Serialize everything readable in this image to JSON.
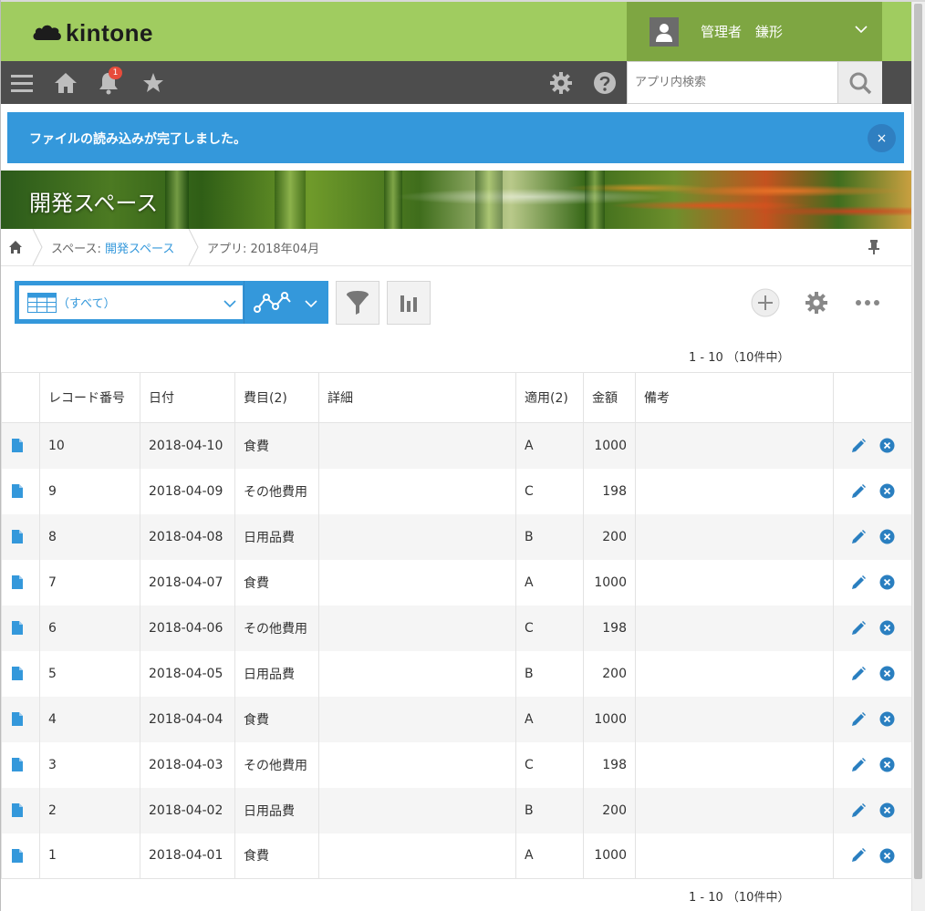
{
  "header": {
    "logo_text": "kintone",
    "user_name": "管理者　鎌形"
  },
  "navbar": {
    "notification_count": "1",
    "search_placeholder": "アプリ内検索"
  },
  "notice": {
    "message": "ファイルの読み込みが完了しました。",
    "close_label": "×"
  },
  "space": {
    "title": "開発スペース"
  },
  "breadcrumb": {
    "space_prefix": "スペース: ",
    "space_name": "開発スペース",
    "app_label": "アプリ: 2018年04月"
  },
  "view": {
    "selected": "（すべて）"
  },
  "pager": {
    "text": "1 - 10 （10件中）"
  },
  "table": {
    "columns": [
      "レコード番号",
      "日付",
      "費目(2)",
      "詳細",
      "適用(2)",
      "金額",
      "備考"
    ],
    "rows": [
      {
        "id": "10",
        "date": "2018-04-10",
        "category": "食費",
        "detail": "",
        "apply": "A",
        "amount": "1000",
        "note": ""
      },
      {
        "id": "9",
        "date": "2018-04-09",
        "category": "その他費用",
        "detail": "",
        "apply": "C",
        "amount": "198",
        "note": ""
      },
      {
        "id": "8",
        "date": "2018-04-08",
        "category": "日用品費",
        "detail": "",
        "apply": "B",
        "amount": "200",
        "note": ""
      },
      {
        "id": "7",
        "date": "2018-04-07",
        "category": "食費",
        "detail": "",
        "apply": "A",
        "amount": "1000",
        "note": ""
      },
      {
        "id": "6",
        "date": "2018-04-06",
        "category": "その他費用",
        "detail": "",
        "apply": "C",
        "amount": "198",
        "note": ""
      },
      {
        "id": "5",
        "date": "2018-04-05",
        "category": "日用品費",
        "detail": "",
        "apply": "B",
        "amount": "200",
        "note": ""
      },
      {
        "id": "4",
        "date": "2018-04-04",
        "category": "食費",
        "detail": "",
        "apply": "A",
        "amount": "1000",
        "note": ""
      },
      {
        "id": "3",
        "date": "2018-04-03",
        "category": "その他費用",
        "detail": "",
        "apply": "C",
        "amount": "198",
        "note": ""
      },
      {
        "id": "2",
        "date": "2018-04-02",
        "category": "日用品費",
        "detail": "",
        "apply": "B",
        "amount": "200",
        "note": ""
      },
      {
        "id": "1",
        "date": "2018-04-01",
        "category": "食費",
        "detail": "",
        "apply": "A",
        "amount": "1000",
        "note": ""
      }
    ]
  },
  "icons": {
    "menu": "hamburger-icon",
    "home": "home-icon",
    "notifications": "bell-icon",
    "favorites": "star-icon",
    "settings": "gear-icon",
    "help": "help-icon",
    "search": "search-icon",
    "record": "document-icon",
    "edit": "pencil-icon",
    "delete": "delete-icon"
  },
  "colors": {
    "header_green": "#a0cc60",
    "user_green": "#7ea642",
    "navbar": "#4d4d4d",
    "accent_blue": "#3498db"
  }
}
